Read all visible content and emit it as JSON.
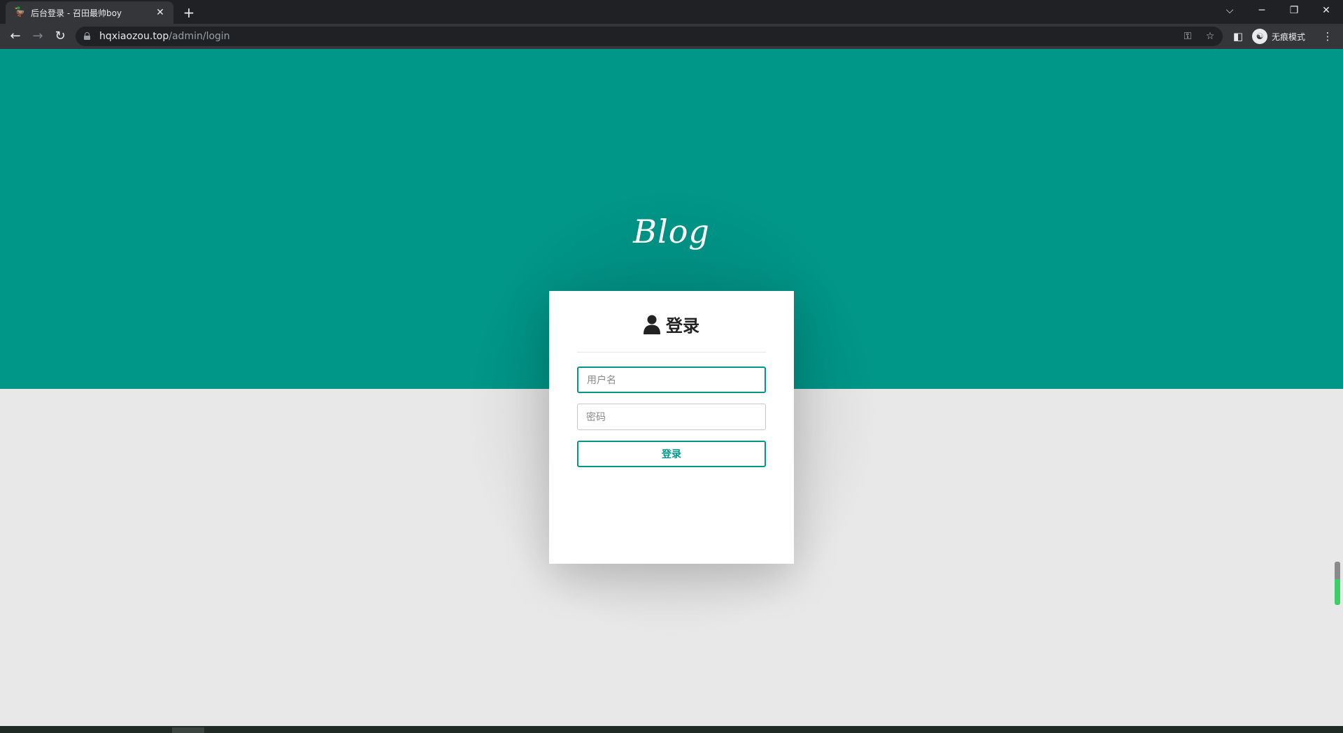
{
  "browser": {
    "tab": {
      "favicon": "duck-icon",
      "title": "后台登录 - 召田最帅boy"
    },
    "new_tab": "+",
    "window_controls": {
      "tab_search": "⌵",
      "minimize": "─",
      "restore": "❐",
      "close": "✕"
    },
    "nav": {
      "back": "←",
      "forward": "→",
      "reload": "↻"
    },
    "address": {
      "host": "hqxiaozou.top",
      "path": "/admin/login"
    },
    "icons": {
      "key": "⚿",
      "bookmark": "☆",
      "side_panel": "◧",
      "menu": "⋮"
    },
    "profile": {
      "avatar": "☯",
      "label": "无痕模式"
    }
  },
  "page": {
    "logo": "Blog",
    "login": {
      "title": "登录",
      "username_placeholder": "用户名",
      "password_placeholder": "密码",
      "submit_label": "登录"
    }
  },
  "colors": {
    "accent": "#009688",
    "background": "#e8e8e8",
    "card": "#ffffff"
  }
}
